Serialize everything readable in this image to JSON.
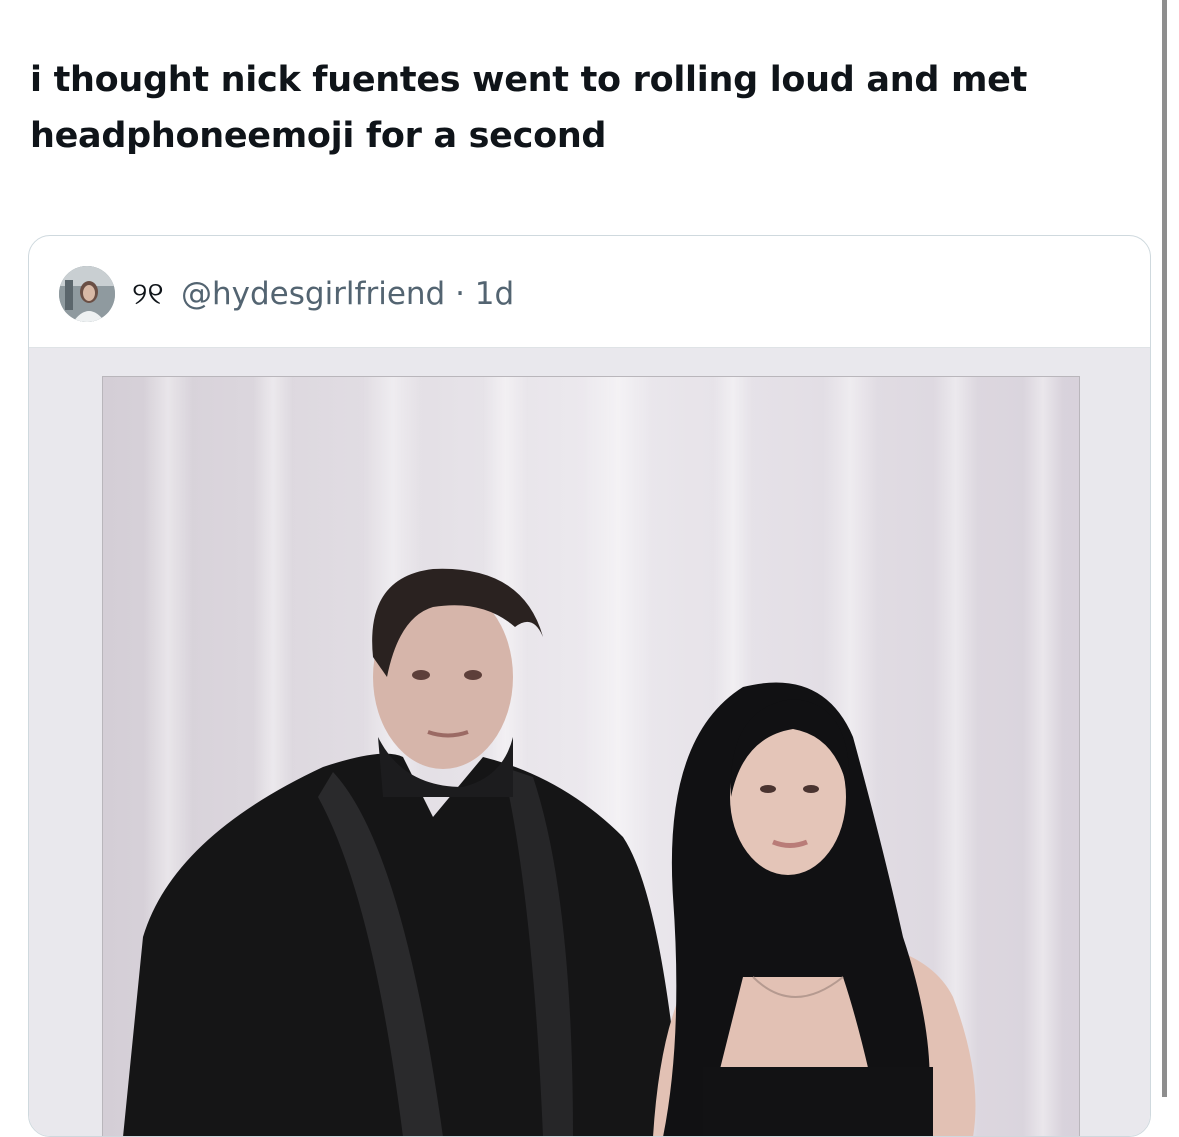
{
  "tweet": {
    "text": "i thought nick fuentes went to rolling loud and met headphoneemoji for a second"
  },
  "quoted": {
    "display_name": "୨୧",
    "handle": "@hydesgirlfriend",
    "separator": "·",
    "timestamp": "1d",
    "avatar_icon": "profile-photo",
    "media_description_icon": "photo"
  },
  "colors": {
    "text_primary": "#0f1419",
    "text_secondary": "#536471",
    "border": "#cfd9de"
  }
}
